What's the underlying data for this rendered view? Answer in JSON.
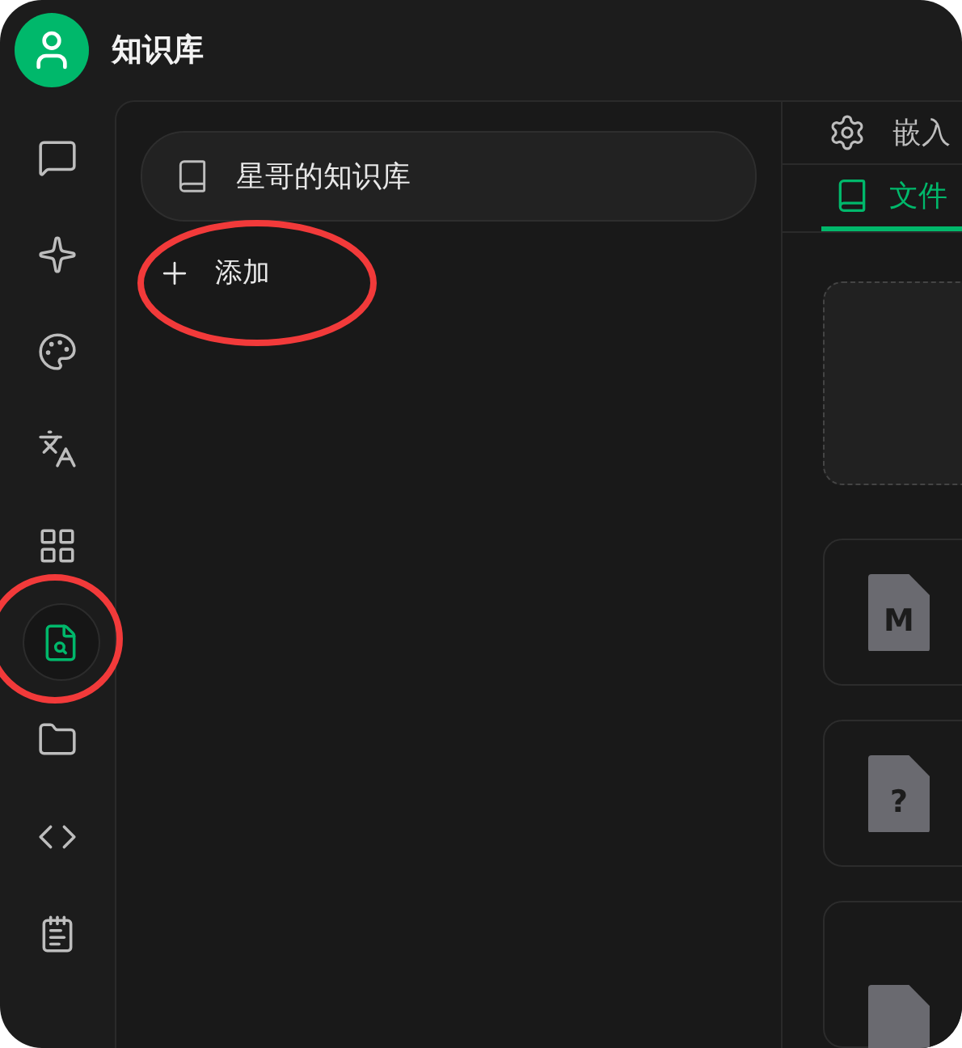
{
  "app": {
    "title": "知识库"
  },
  "rail": [
    {
      "selected": false,
      "circled": false
    },
    {
      "selected": false,
      "circled": false
    },
    {
      "selected": false,
      "circled": false
    },
    {
      "selected": false,
      "circled": false
    },
    {
      "selected": false,
      "circled": false
    },
    {
      "selected": true,
      "circled": true
    },
    {
      "selected": false,
      "circled": false
    },
    {
      "selected": false,
      "circled": false
    },
    {
      "selected": false,
      "circled": false
    }
  ],
  "knowledge_bases": [
    {
      "name": "星哥的知识库"
    }
  ],
  "add_button": {
    "label": "添加",
    "circled": true
  },
  "settings_tab": {
    "label": "嵌入"
  },
  "tabs": [
    {
      "label": "文件",
      "selected": true
    }
  ],
  "files": [
    {
      "glyph": "M"
    },
    {
      "glyph": "?"
    },
    {
      "kind": "partial"
    }
  ]
}
